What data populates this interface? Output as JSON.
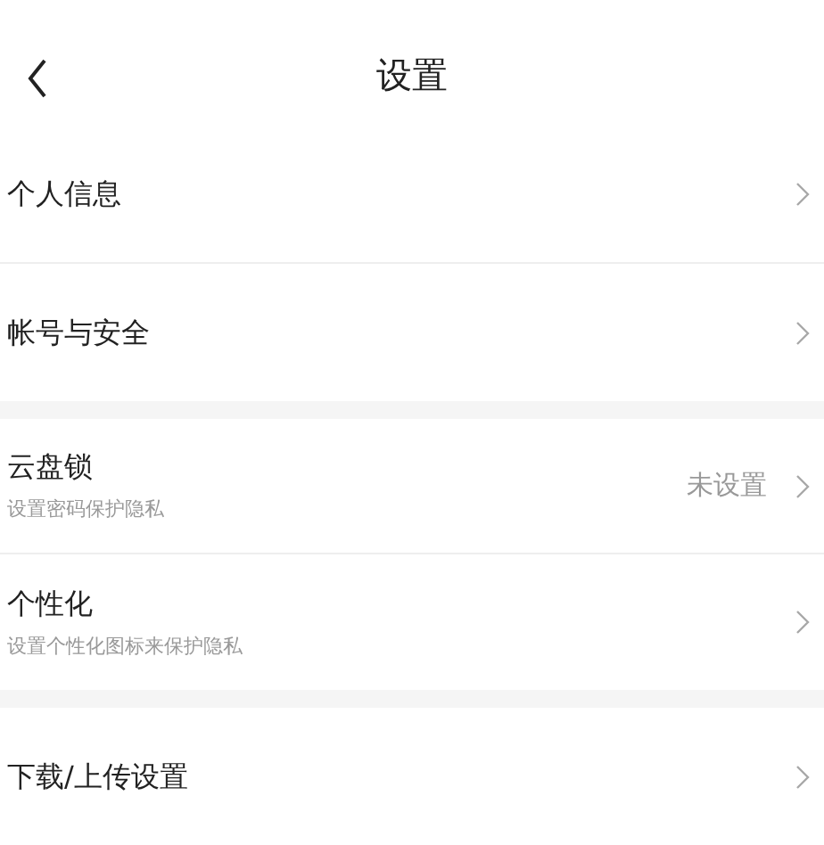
{
  "header": {
    "title": "设置"
  },
  "groups": [
    {
      "items": [
        {
          "title": "个人信息"
        },
        {
          "title": "帐号与安全"
        }
      ]
    },
    {
      "items": [
        {
          "title": "云盘锁",
          "subtitle": "设置密码保护隐私",
          "value": "未设置"
        },
        {
          "title": "个性化",
          "subtitle": "设置个性化图标来保护隐私"
        }
      ]
    },
    {
      "items": [
        {
          "title": "下载/上传设置"
        }
      ]
    }
  ]
}
